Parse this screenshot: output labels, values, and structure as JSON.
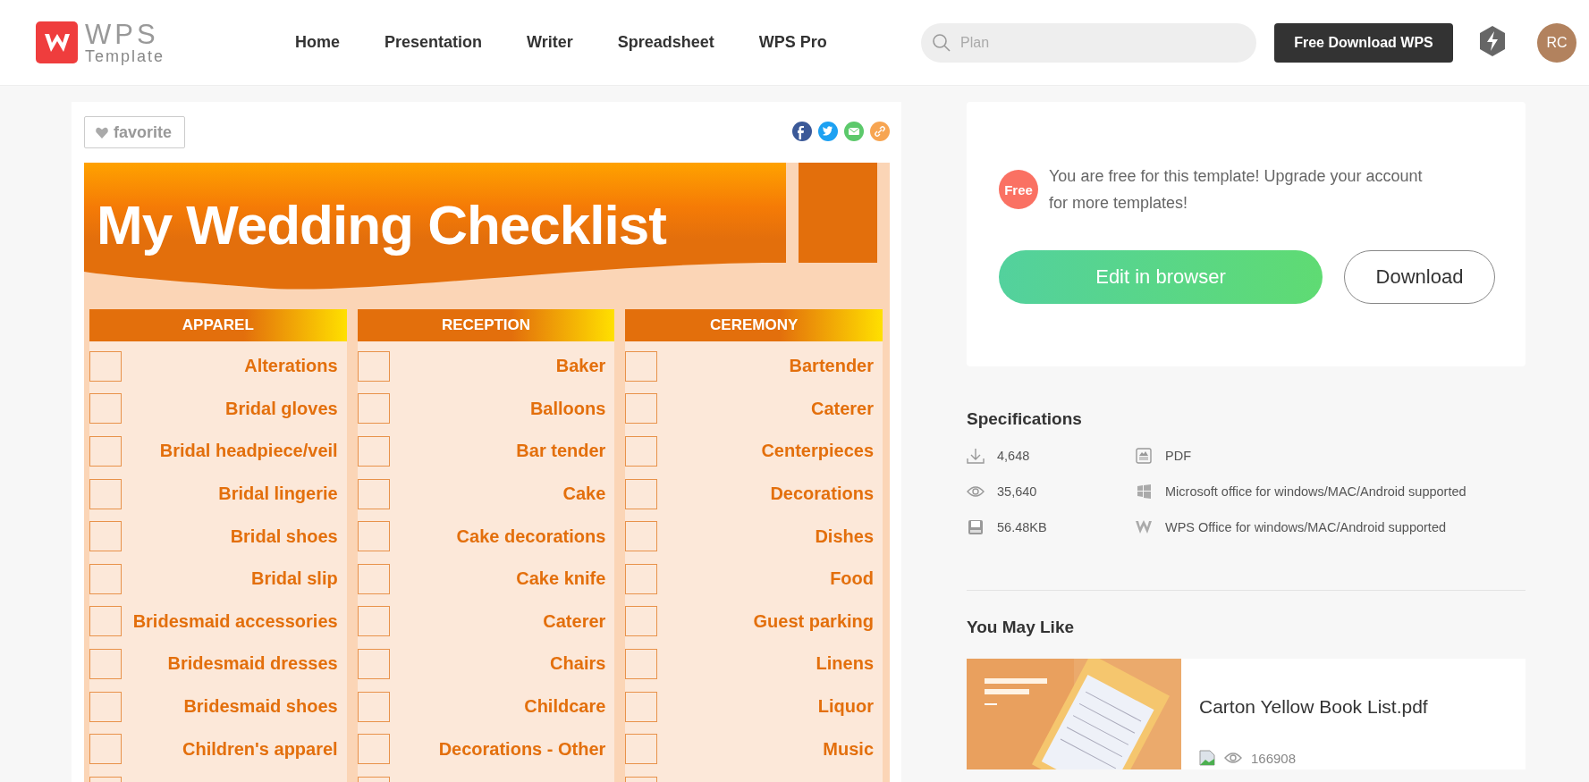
{
  "header": {
    "logo": {
      "title": "WPS",
      "subtitle": "Template"
    },
    "nav": [
      {
        "label": "Home"
      },
      {
        "label": "Presentation"
      },
      {
        "label": "Writer"
      },
      {
        "label": "Spreadsheet"
      },
      {
        "label": "WPS Pro"
      }
    ],
    "search": {
      "placeholder": "Plan"
    },
    "download_button": "Free Download WPS",
    "avatar": "RC"
  },
  "preview": {
    "favorite": "favorite",
    "share": [
      {
        "kind": "facebook",
        "color": "#3b5998"
      },
      {
        "kind": "twitter",
        "color": "#1da1f2"
      },
      {
        "kind": "email",
        "color": "#5cc96b"
      },
      {
        "kind": "link",
        "color": "#f7a552"
      }
    ],
    "document": {
      "title": "My Wedding Checklist",
      "columns": [
        {
          "heading": "APPAREL",
          "items": [
            {
              "label": "Alterations",
              "checked": false
            },
            {
              "label": "Bridal gloves",
              "checked": false
            },
            {
              "label": "Bridal headpiece/veil",
              "checked": false
            },
            {
              "label": "Bridal lingerie",
              "checked": false
            },
            {
              "label": "Bridal shoes",
              "checked": false
            },
            {
              "label": "Bridal slip",
              "checked": false
            },
            {
              "label": "Bridesmaid accessories",
              "checked": false
            },
            {
              "label": "Bridesmaid dresses",
              "checked": false
            },
            {
              "label": "Bridesmaid shoes",
              "checked": false
            },
            {
              "label": "Children's apparel",
              "checked": false
            }
          ]
        },
        {
          "heading": "RECEPTION",
          "items": [
            {
              "label": "Baker",
              "checked": false
            },
            {
              "label": "Balloons",
              "checked": false
            },
            {
              "label": "Bar tender",
              "checked": false
            },
            {
              "label": "Cake",
              "checked": false
            },
            {
              "label": "Cake decorations",
              "checked": false
            },
            {
              "label": "Cake knife",
              "checked": false
            },
            {
              "label": "Caterer",
              "checked": false
            },
            {
              "label": "Chairs",
              "checked": false
            },
            {
              "label": "Childcare",
              "checked": false
            },
            {
              "label": "Decorations - Other",
              "checked": false
            }
          ]
        },
        {
          "heading": "CEREMONY",
          "items": [
            {
              "label": "Bartender",
              "checked": false
            },
            {
              "label": "Caterer",
              "checked": false
            },
            {
              "label": "Centerpieces",
              "checked": false
            },
            {
              "label": "Decorations",
              "checked": false
            },
            {
              "label": "Dishes",
              "checked": false
            },
            {
              "label": "Food",
              "checked": false
            },
            {
              "label": "Guest parking",
              "checked": false
            },
            {
              "label": "Linens",
              "checked": false
            },
            {
              "label": "Liquor",
              "checked": false
            },
            {
              "label": "Music",
              "checked": false
            }
          ]
        }
      ]
    }
  },
  "offer": {
    "badge": "Free",
    "message": "You are free for this template! Upgrade your account for more templates!",
    "edit_button": "Edit in browser",
    "download_button": "Download"
  },
  "specifications": {
    "title": "Specifications",
    "items": [
      {
        "kind": "downloads",
        "text": "4,648"
      },
      {
        "kind": "format",
        "text": "PDF"
      },
      {
        "kind": "views",
        "text": "35,640"
      },
      {
        "kind": "microsoft",
        "text": "Microsoft office for windows/MAC/Android supported"
      },
      {
        "kind": "size",
        "text": "56.48KB"
      },
      {
        "kind": "wps",
        "text": "WPS Office for windows/MAC/Android supported"
      }
    ]
  },
  "you_may_like": {
    "title": "You May Like",
    "items": [
      {
        "kind": "picture",
        "name": "Carton Yellow Book List.pdf",
        "views": "166908"
      }
    ]
  }
}
